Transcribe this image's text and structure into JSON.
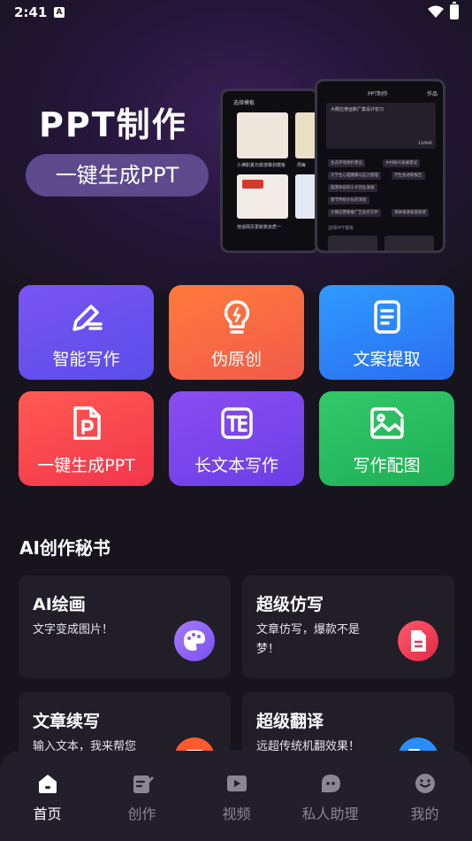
{
  "status_bar": {
    "time": "2:41",
    "notification_letter": "A"
  },
  "banner": {
    "title": "PPT制作",
    "subtitle": "一键生成PPT",
    "mock_back": {
      "header": "选择模板",
      "cards": [
        "小满职夏日旅游策划模板",
        "周每"
      ],
      "caption": "地道网页更新数资质一"
    },
    "mock_front": {
      "title": "PPT制作",
      "action": "作品",
      "input_text": "大概应使运新广案设计初习",
      "counter": "12/600",
      "tags": [
        "生态环境保护建议",
        "乡村振兴发展建议",
        "大学生心理健康与压力管理",
        "学生会述职报告",
        "旅游体验的十大创业发展",
        "春节传统文化的演变",
        "大健应聘者推广告处的方针",
        "演讲来源发旅游感"
      ],
      "footer": "选择PPT模板"
    }
  },
  "tiles": [
    {
      "label": "智能写作",
      "icon": "pen-write-icon"
    },
    {
      "label": "伪原创",
      "icon": "lightbulb-icon"
    },
    {
      "label": "文案提取",
      "icon": "document-icon"
    },
    {
      "label": "一键生成PPT",
      "icon": "ppt-file-icon"
    },
    {
      "label": "长文本写作",
      "icon": "text-box-icon"
    },
    {
      "label": "写作配图",
      "icon": "image-edit-icon"
    }
  ],
  "colors": {
    "tile_1": [
      "#7a55f5",
      "#5a4de8"
    ],
    "tile_2": [
      "#ff7a3c",
      "#f25a4a"
    ],
    "tile_3": [
      "#2f9bff",
      "#2a6df0"
    ],
    "tile_4": [
      "#ff5a52",
      "#f2364b"
    ],
    "tile_5": [
      "#8a4df2",
      "#6b3ee6"
    ],
    "tile_6": [
      "#33c96a",
      "#1fae55"
    ]
  },
  "section": {
    "title": "AI创作秘书"
  },
  "cards": [
    {
      "title": "AI绘画",
      "desc": "文字变成图片！",
      "icon": "palette-icon"
    },
    {
      "title": "超级仿写",
      "desc": "文章仿写，爆款不是梦！",
      "icon": "doc-copy-icon"
    },
    {
      "title": "文章续写",
      "desc": "输入文本，我来帮您",
      "icon": "continue-icon"
    },
    {
      "title": "超级翻译",
      "desc": "远超传统机翻效果！",
      "icon": "translate-icon"
    }
  ],
  "nav": [
    {
      "label": "首页",
      "icon": "home-icon",
      "active": true
    },
    {
      "label": "创作",
      "icon": "edit-note-icon",
      "active": false
    },
    {
      "label": "视频",
      "icon": "video-icon",
      "active": false
    },
    {
      "label": "私人助理",
      "icon": "assistant-chat-icon",
      "active": false
    },
    {
      "label": "我的",
      "icon": "profile-icon",
      "active": false
    }
  ]
}
